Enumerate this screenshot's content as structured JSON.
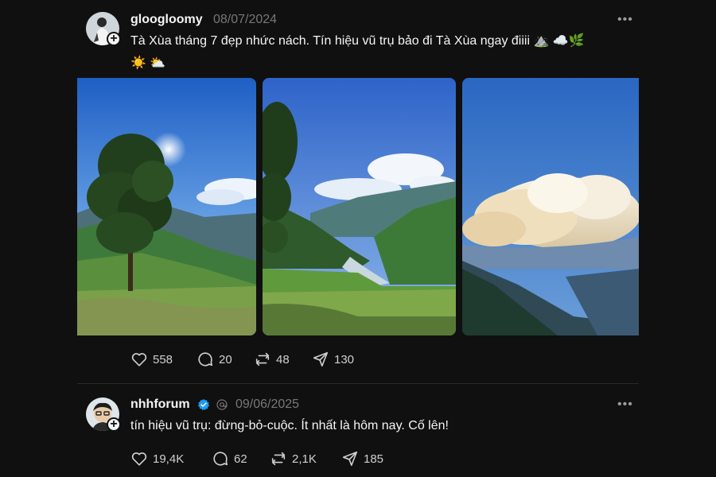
{
  "posts": [
    {
      "username": "gloogloomy",
      "date": "08/07/2024",
      "text": "Tà Xùa tháng 7 đẹp nhức nách. Tín hiệu vũ trụ bảo đi Tà Xùa ngay điiii ⛰️ ☁️🌿",
      "text_line2": "☀️ ⛅",
      "more": "•••",
      "images": [
        {
          "name": "tree-on-hill-photo"
        },
        {
          "name": "valley-lake-photo"
        },
        {
          "name": "clouds-over-mountains-photo"
        }
      ],
      "likes": "558",
      "replies": "20",
      "reposts": "48",
      "shares": "130"
    },
    {
      "username": "nhhforum",
      "date": "09/06/2025",
      "text": "tín hiệu vũ trụ: đừng-bỏ-cuộc. Ít nhất là hôm nay. Cố lên!",
      "more": "•••",
      "likes": "19,4K",
      "replies": "62",
      "reposts": "2,1K",
      "shares": "185"
    }
  ],
  "colors": {
    "background": "#101010",
    "text": "#f3f5f7",
    "muted": "#777777",
    "verified": "#1d9bf0"
  },
  "icons": [
    "heart-icon",
    "comment-icon",
    "repost-icon",
    "share-icon",
    "plus-icon",
    "verified-badge-icon",
    "threads-logo-icon",
    "more-icon"
  ]
}
